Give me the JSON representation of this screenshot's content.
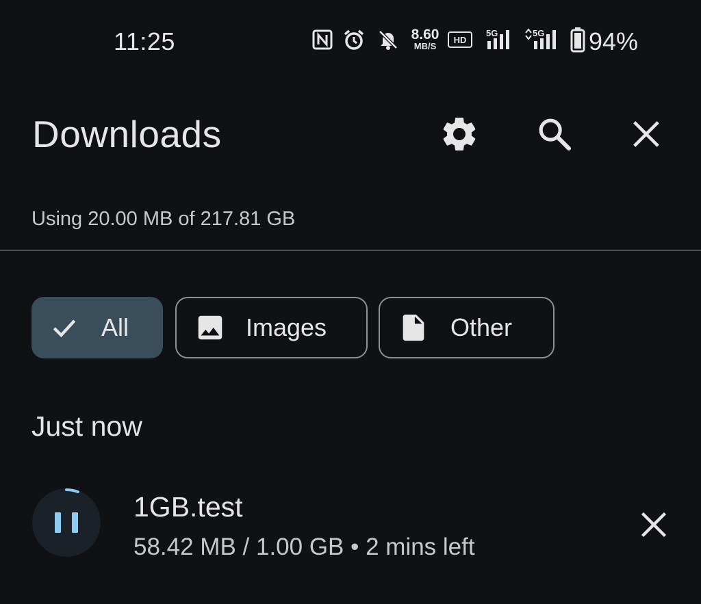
{
  "status_bar": {
    "time": "11:25",
    "network_speed_value": "8.60",
    "network_speed_unit": "MB/S",
    "hd_label": "HD",
    "network_label_1": "5G",
    "network_label_2": "5G",
    "battery_percent": "94%",
    "icons": [
      "nfc-icon",
      "alarm-icon",
      "notifications-off-icon",
      "hd-voice-icon",
      "signal-icon",
      "signal-icon",
      "battery-icon"
    ]
  },
  "header": {
    "title": "Downloads",
    "actions": [
      "settings-icon",
      "search-icon",
      "close-icon"
    ]
  },
  "storage": {
    "text": "Using 20.00 MB of 217.81 GB"
  },
  "filters": [
    {
      "label": "All",
      "icon": "check-icon",
      "selected": true
    },
    {
      "label": "Images",
      "icon": "image-icon",
      "selected": false
    },
    {
      "label": "Other",
      "icon": "file-icon",
      "selected": false
    }
  ],
  "section": {
    "title": "Just now"
  },
  "downloads": [
    {
      "name": "1GB.test",
      "progress_text": "58.42 MB / 1.00 GB • 2 mins left",
      "progress_fraction": 0.057,
      "state": "downloading",
      "accent_color": "#8ecbf0"
    }
  ],
  "colors": {
    "background": "#0f1114",
    "chip_selected_bg": "#3a4d5a",
    "progress_accent": "#8ecbf0"
  }
}
